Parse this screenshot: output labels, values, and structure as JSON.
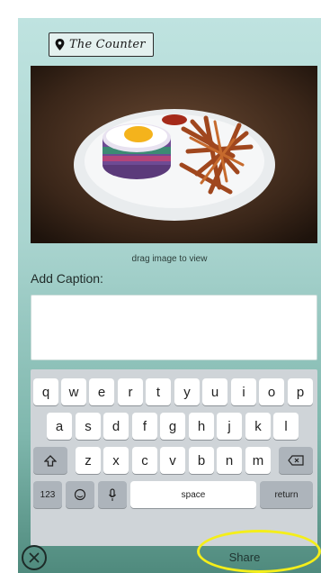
{
  "location": {
    "name": "The Counter",
    "icon": "map-pin-icon"
  },
  "photo": {
    "subject": "burger-and-fries-plate"
  },
  "drag_hint": "drag image to view",
  "caption": {
    "label": "Add Caption:",
    "value": "",
    "placeholder": ""
  },
  "keyboard": {
    "row1": [
      "q",
      "w",
      "e",
      "r",
      "t",
      "y",
      "u",
      "i",
      "o",
      "p"
    ],
    "row2": [
      "a",
      "s",
      "d",
      "f",
      "g",
      "h",
      "j",
      "k",
      "l"
    ],
    "row3": [
      "z",
      "x",
      "c",
      "v",
      "b",
      "n",
      "m"
    ],
    "numbers_label": "123",
    "space_label": "space",
    "return_label": "return",
    "icons": {
      "shift": "shift-icon",
      "delete": "backspace-icon",
      "emoji": "emoji-icon",
      "mic": "microphone-icon"
    }
  },
  "actions": {
    "cancel_icon": "close-circle-icon",
    "share_label": "Share"
  },
  "colors": {
    "highlight": "#f4ee1a",
    "background_top": "#bfe3e0",
    "background_bottom": "#4f8a7d"
  }
}
